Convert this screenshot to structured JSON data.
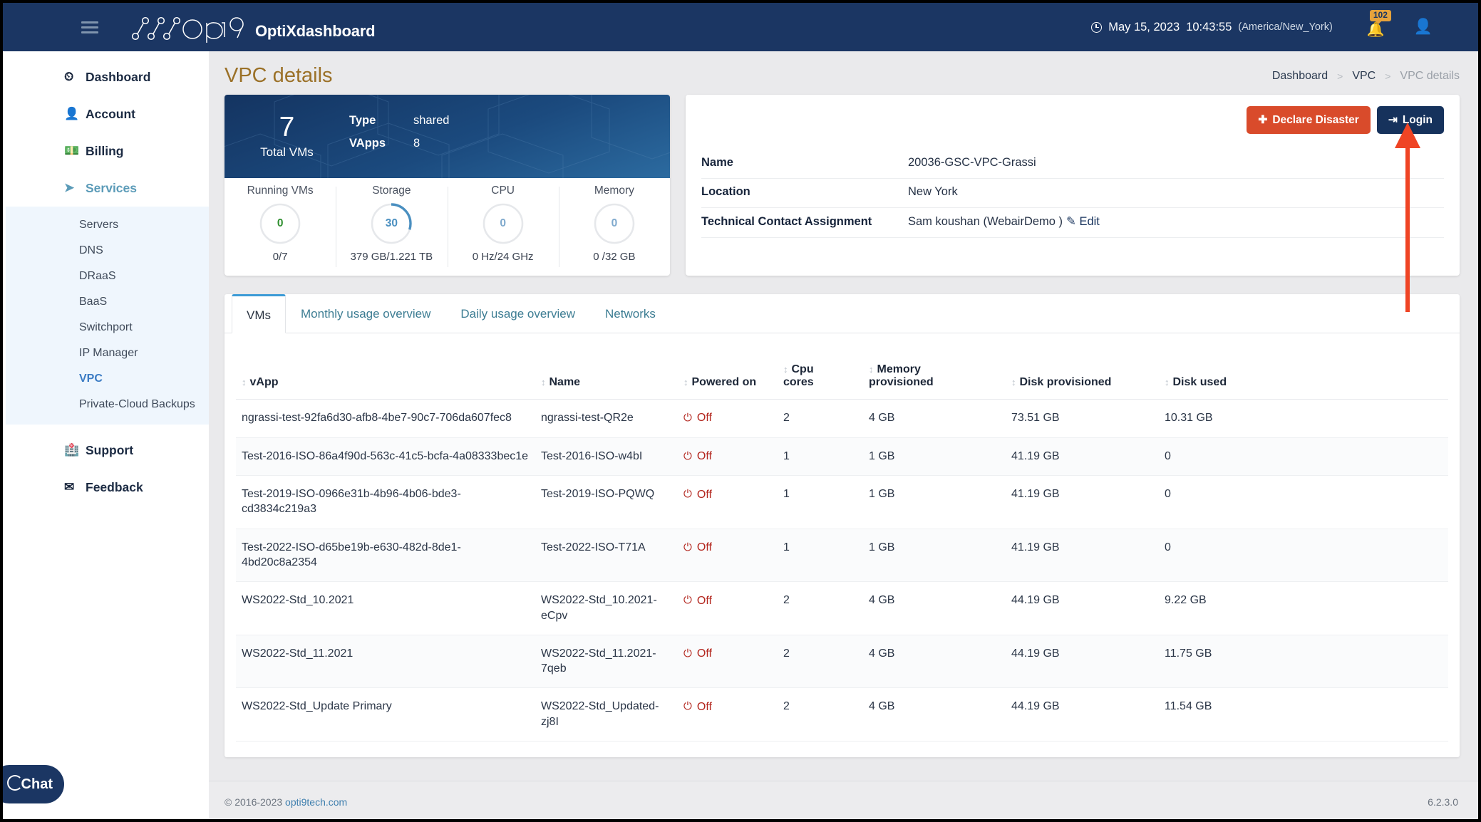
{
  "topbar": {
    "menu_icon": "hamburger-icon",
    "brand_logo": "opti9-logo",
    "brand_title": "OptiXdashboard",
    "clock_icon": "clock-icon",
    "date": "May 15, 2023",
    "time": "10:43:55",
    "timezone": "(America/New_York)",
    "notification_icon": "bell-icon",
    "notification_count": "102",
    "user_icon": "user-icon"
  },
  "sidebar": {
    "items": [
      {
        "label": "Dashboard",
        "icon": "speedometer-icon",
        "active": false
      },
      {
        "label": "Account",
        "icon": "user-icon",
        "active": false
      },
      {
        "label": "Billing",
        "icon": "banknote-icon",
        "active": false
      },
      {
        "label": "Services",
        "icon": "rocket-icon",
        "active": true
      }
    ],
    "services_submenu": [
      {
        "label": "Servers",
        "active": false
      },
      {
        "label": "DNS",
        "active": false
      },
      {
        "label": "DRaaS",
        "active": false
      },
      {
        "label": "BaaS",
        "active": false
      },
      {
        "label": "Switchport",
        "active": false
      },
      {
        "label": "IP Manager",
        "active": false
      },
      {
        "label": "VPC",
        "active": true
      },
      {
        "label": "Private-Cloud Backups",
        "active": false
      }
    ],
    "bottom_items": [
      {
        "label": "Support",
        "icon": "first-aid-kit-icon"
      },
      {
        "label": "Feedback",
        "icon": "envelope-icon"
      }
    ],
    "chat_label": "Chat",
    "chat_icon": "chat-circle-icon"
  },
  "page": {
    "title": "VPC details",
    "breadcrumb": [
      {
        "label": "Dashboard",
        "muted": false
      },
      {
        "label": "VPC",
        "muted": false
      },
      {
        "label": "VPC details",
        "muted": true
      }
    ],
    "breadcrumb_separator": ">"
  },
  "summary_card": {
    "total_vms_value": "7",
    "total_vms_label": "Total VMs",
    "type_label": "Type",
    "type_value": "shared",
    "vapps_label": "VApps",
    "vapps_value": "8",
    "gauges": [
      {
        "title": "Running VMs",
        "value": "0",
        "sub": "0/7",
        "percent": 0,
        "color": "#2f8f2f"
      },
      {
        "title": "Storage",
        "value": "30",
        "sub": "379 GB/1.221 TB",
        "percent": 30,
        "color": "#4a8fc0"
      },
      {
        "title": "CPU",
        "value": "0",
        "sub": "0 Hz/24 GHz",
        "percent": 0,
        "color": "#7fa9cd"
      },
      {
        "title": "Memory",
        "value": "0",
        "sub": "0 /32 GB",
        "percent": 0,
        "color": "#7fa9cd"
      }
    ]
  },
  "detail_card": {
    "declare_disaster_label": "Declare Disaster",
    "declare_disaster_icon": "shield-plus-icon",
    "login_label": "Login",
    "login_icon": "sign-in-icon",
    "rows": [
      {
        "key": "Name",
        "value": "20036-GSC-VPC-Grassi",
        "edit": ""
      },
      {
        "key": "Location",
        "value": "New York",
        "edit": ""
      },
      {
        "key": "Technical Contact Assignment",
        "value": "Sam koushan (WebairDemo )",
        "edit": "Edit",
        "edit_icon": "pencil-square-icon"
      }
    ]
  },
  "tabs": [
    {
      "label": "VMs",
      "active": true
    },
    {
      "label": "Monthly usage overview",
      "active": false
    },
    {
      "label": "Daily usage overview",
      "active": false
    },
    {
      "label": "Networks",
      "active": false
    }
  ],
  "table": {
    "sort_icon": "sort-arrows-icon",
    "columns": [
      "vApp",
      "Name",
      "Powered on",
      "Cpu\ncores",
      "Memory\nprovisioned",
      "Disk provisioned",
      "Disk used"
    ],
    "power_icon": "power-icon",
    "rows": [
      {
        "vapp": "ngrassi-test-92fa6d30-afb8-4be7-90c7-706da607fec8",
        "name": "ngrassi-test-QR2e",
        "powered_on": "Off",
        "cpu_cores": "2",
        "memory_provisioned": "4 GB",
        "disk_provisioned": "73.51 GB",
        "disk_used": "10.31 GB"
      },
      {
        "vapp": "Test-2016-ISO-86a4f90d-563c-41c5-bcfa-4a08333bec1e",
        "name": "Test-2016-ISO-w4bI",
        "powered_on": "Off",
        "cpu_cores": "1",
        "memory_provisioned": "1 GB",
        "disk_provisioned": "41.19 GB",
        "disk_used": "0"
      },
      {
        "vapp": "Test-2019-ISO-0966e31b-4b96-4b06-bde3-cd3834c219a3",
        "name": "Test-2019-ISO-PQWQ",
        "powered_on": "Off",
        "cpu_cores": "1",
        "memory_provisioned": "1 GB",
        "disk_provisioned": "41.19 GB",
        "disk_used": "0"
      },
      {
        "vapp": "Test-2022-ISO-d65be19b-e630-482d-8de1-4bd20c8a2354",
        "name": "Test-2022-ISO-T71A",
        "powered_on": "Off",
        "cpu_cores": "1",
        "memory_provisioned": "1 GB",
        "disk_provisioned": "41.19 GB",
        "disk_used": "0"
      },
      {
        "vapp": "WS2022-Std_10.2021",
        "name": "WS2022-Std_10.2021-eCpv",
        "powered_on": "Off",
        "cpu_cores": "2",
        "memory_provisioned": "4 GB",
        "disk_provisioned": "44.19 GB",
        "disk_used": "9.22 GB"
      },
      {
        "vapp": "WS2022-Std_11.2021",
        "name": "WS2022-Std_11.2021-7qeb",
        "powered_on": "Off",
        "cpu_cores": "2",
        "memory_provisioned": "4 GB",
        "disk_provisioned": "44.19 GB",
        "disk_used": "11.75 GB"
      },
      {
        "vapp": "WS2022-Std_Update Primary",
        "name": "WS2022-Std_Updated-zj8I",
        "powered_on": "Off",
        "cpu_cores": "2",
        "memory_provisioned": "4 GB",
        "disk_provisioned": "44.19 GB",
        "disk_used": "11.54 GB"
      }
    ]
  },
  "footer": {
    "copyright": "© 2016-2023",
    "link": "opti9tech.com",
    "version": "6.2.3.0"
  },
  "annotation": {
    "arrow_color": "#ef4424",
    "points_to": "login-button"
  },
  "colors": {
    "brand_navy": "#1b3663",
    "accent_blue": "#3c9bd6",
    "danger_red": "#d94b2b",
    "title_gold": "#9b7128"
  }
}
